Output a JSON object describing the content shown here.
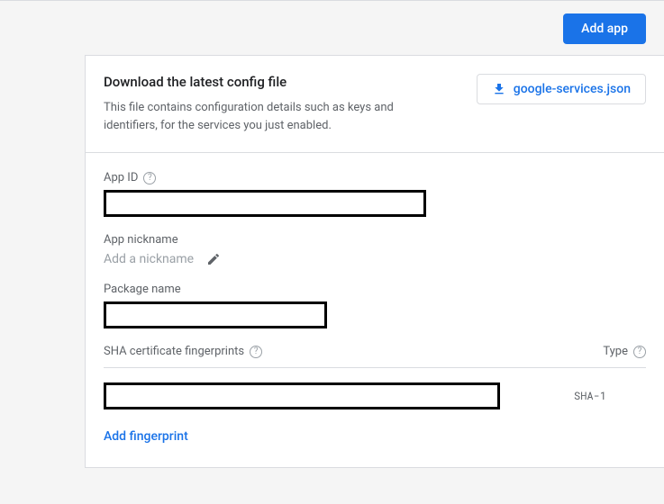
{
  "header": {
    "add_app_label": "Add app"
  },
  "config": {
    "title": "Download the latest config file",
    "description": "This file contains configuration details such as keys and identifiers, for the services you just enabled.",
    "download_label": "google-services.json"
  },
  "fields": {
    "app_id_label": "App ID",
    "app_nickname_label": "App nickname",
    "nickname_placeholder": "Add a nickname",
    "package_name_label": "Package name"
  },
  "sha": {
    "header": "SHA certificate fingerprints",
    "type_header": "Type",
    "type_value": "SHA-1",
    "add_fingerprint_label": "Add fingerprint"
  }
}
